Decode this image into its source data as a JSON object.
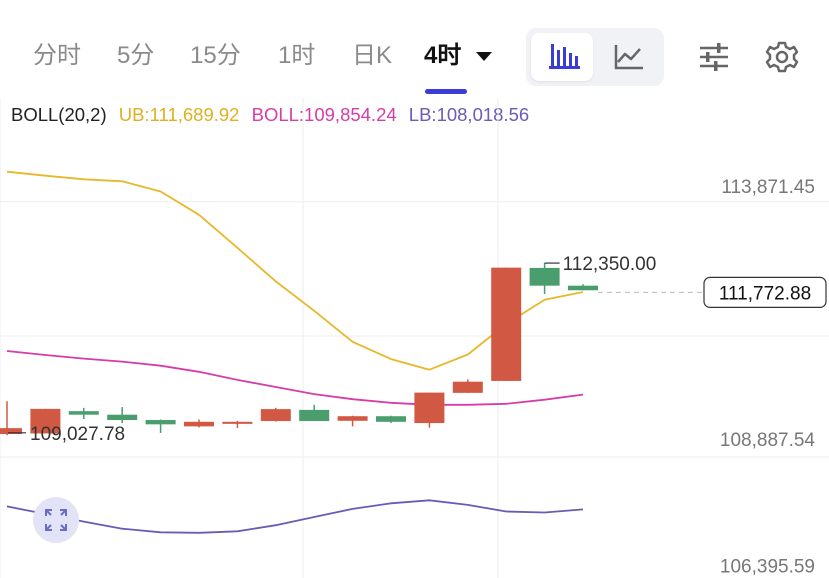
{
  "tabs": [
    {
      "label": "分时"
    },
    {
      "label": "5分"
    },
    {
      "label": "15分"
    },
    {
      "label": "1时"
    },
    {
      "label": "日K"
    },
    {
      "label": "4时"
    }
  ],
  "active_tab": "4时",
  "chart_type_buttons": [
    {
      "icon": "candlestick-icon",
      "selected": true
    },
    {
      "icon": "line-chart-icon",
      "selected": false
    }
  ],
  "toolbar_icons": [
    "sliders-icon",
    "gear-icon",
    "expand-icon"
  ],
  "indicator": {
    "name": "BOLL(20,2)",
    "ub": "UB:111,689.92",
    "boll": "BOLL:109,854.24",
    "lb": "LB:108,018.56"
  },
  "colors": {
    "up": "#4a9e6e",
    "down": "#d15842",
    "ub": "#e7b829",
    "boll": "#d63da8",
    "lb": "#6b5bb5",
    "accent": "#3b3bd6"
  },
  "chart_data": {
    "type": "candlestick",
    "y_axis_labels": [
      "113,871.45",
      "108,887.54",
      "106,395.59"
    ],
    "y_axis_values": [
      113871.45,
      108887.54,
      106395.59
    ],
    "ylim": [
      106150,
      115600
    ],
    "grid": true,
    "current_price_label": "111,772.88",
    "current_price": 111772.88,
    "high_annotation": "112,350.00",
    "high_value": 112350.0,
    "low_annotation": "109,027.78",
    "low_value": 109027.78,
    "candles": [
      {
        "open": 109100,
        "close": 108985,
        "high": 109630,
        "low": 108960
      },
      {
        "open": 109480,
        "close": 108995,
        "high": 109480,
        "low": 108995
      },
      {
        "open": 109365,
        "close": 109435,
        "high": 109500,
        "low": 109280
      },
      {
        "open": 109260,
        "close": 109365,
        "high": 109515,
        "low": 109200
      },
      {
        "open": 109175,
        "close": 109260,
        "high": 109270,
        "low": 109005
      },
      {
        "open": 109225,
        "close": 109135,
        "high": 109270,
        "low": 109115
      },
      {
        "open": 109225,
        "close": 109185,
        "high": 109245,
        "low": 109105
      },
      {
        "open": 109475,
        "close": 109240,
        "high": 109500,
        "low": 109230
      },
      {
        "open": 109240,
        "close": 109460,
        "high": 109560,
        "low": 109240
      },
      {
        "open": 109335,
        "close": 109245,
        "high": 109345,
        "low": 109135
      },
      {
        "open": 109225,
        "close": 109335,
        "high": 109345,
        "low": 109200
      },
      {
        "open": 109800,
        "close": 109200,
        "high": 109800,
        "low": 109110
      },
      {
        "open": 110015,
        "close": 109795,
        "high": 110060,
        "low": 109795
      },
      {
        "open": 112260,
        "close": 110030,
        "high": 112260,
        "low": 110030
      },
      {
        "open": 111905,
        "close": 112255,
        "high": 112350,
        "low": 111740
      },
      {
        "open": 111815,
        "close": 111905,
        "high": 111935,
        "low": 111815
      }
    ],
    "ub_line": [
      114150,
      114070,
      114000,
      113960,
      113760,
      113300,
      112650,
      111990,
      111410,
      110800,
      110460,
      110250,
      110550,
      111150,
      111630,
      111780
    ],
    "boll_line": [
      110620,
      110540,
      110470,
      110410,
      110330,
      110210,
      110050,
      109910,
      109770,
      109670,
      109600,
      109560,
      109560,
      109580,
      109660,
      109760
    ],
    "lb_line": [
      107560,
      107410,
      107260,
      107120,
      107050,
      107040,
      107070,
      107190,
      107350,
      107510,
      107620,
      107680,
      107590,
      107460,
      107440,
      107500
    ]
  }
}
